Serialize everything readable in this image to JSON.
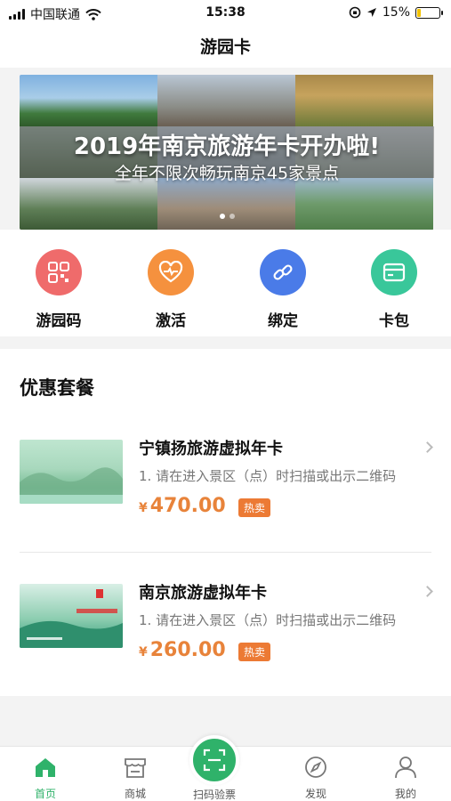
{
  "status_bar": {
    "carrier": "中国联通",
    "time": "15:38",
    "battery": "15%",
    "battery_level": 0.15
  },
  "nav": {
    "title": "游园卡"
  },
  "banner": {
    "title": "2019年南京旅游年卡开办啦!",
    "subtitle": "全年不限次畅玩南京45家景点",
    "slides": 2,
    "active_slide": 1
  },
  "quick_actions": [
    {
      "label": "游园码",
      "icon": "qrcode-icon",
      "color": "#ef6b6b"
    },
    {
      "label": "激活",
      "icon": "heart-pulse-icon",
      "color": "#f5913e"
    },
    {
      "label": "绑定",
      "icon": "link-icon",
      "color": "#4a7be8"
    },
    {
      "label": "卡包",
      "icon": "card-icon",
      "color": "#39c79a"
    }
  ],
  "packages": {
    "title": "优惠套餐",
    "items": [
      {
        "name": "宁镇扬旅游虚拟年卡",
        "desc": "1. 请在进入景区（点）时扫描或出示二维码",
        "currency": "¥",
        "price": "470.00",
        "tag": "热卖"
      },
      {
        "name": "南京旅游虚拟年卡",
        "desc": "1. 请在进入景区（点）时扫描或出示二维码",
        "currency": "¥",
        "price": "260.00",
        "tag": "热卖"
      }
    ]
  },
  "tabbar": {
    "items": [
      {
        "label": "首页",
        "icon": "home-icon",
        "active": true
      },
      {
        "label": "商城",
        "icon": "store-icon",
        "active": false
      },
      {
        "label": "扫码验票",
        "icon": "scan-icon",
        "active": false
      },
      {
        "label": "发现",
        "icon": "compass-icon",
        "active": false
      },
      {
        "label": "我的",
        "icon": "user-icon",
        "active": false
      }
    ]
  },
  "colors": {
    "brand_green": "#2fb26a",
    "price_orange": "#e8833a",
    "tag_orange": "#ec7a34"
  }
}
